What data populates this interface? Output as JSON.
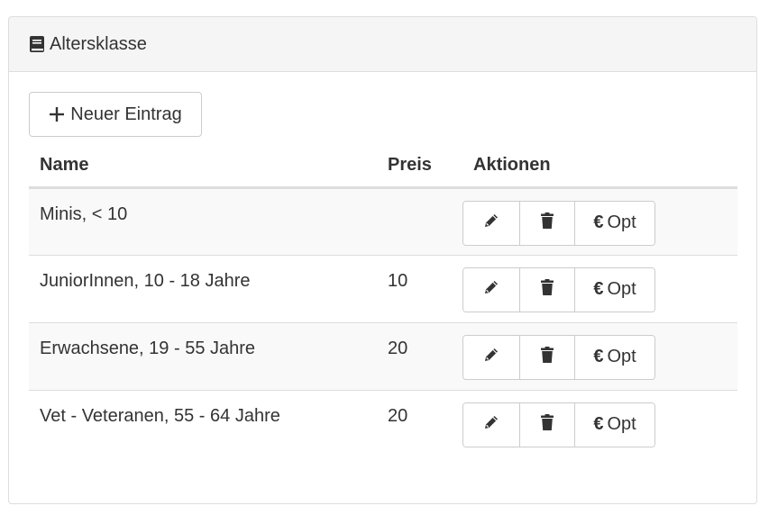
{
  "panel": {
    "title": "Altersklasse",
    "title_icon": "book-icon"
  },
  "toolbar": {
    "new_entry_label": "Neuer Eintrag",
    "new_entry_icon": "plus-icon"
  },
  "table": {
    "headers": {
      "name": "Name",
      "preis": "Preis",
      "aktionen": "Aktionen"
    },
    "rows": [
      {
        "name": "Minis, < 10",
        "preis": ""
      },
      {
        "name": "JuniorInnen, 10 - 18 Jahre",
        "preis": "10"
      },
      {
        "name": "Erwachsene, 19 - 55 Jahre",
        "preis": "20"
      },
      {
        "name": "Vet - Veteranen, 55 - 64 Jahre",
        "preis": "20"
      }
    ],
    "actions": {
      "edit_icon": "pencil-icon",
      "delete_icon": "trash-icon",
      "opt_symbol": "€",
      "opt_label": "Opt"
    }
  },
  "colors": {
    "border": "#dddddd",
    "heading_bg": "#f5f5f5",
    "stripe_bg": "#f9f9f9",
    "text": "#333333"
  }
}
